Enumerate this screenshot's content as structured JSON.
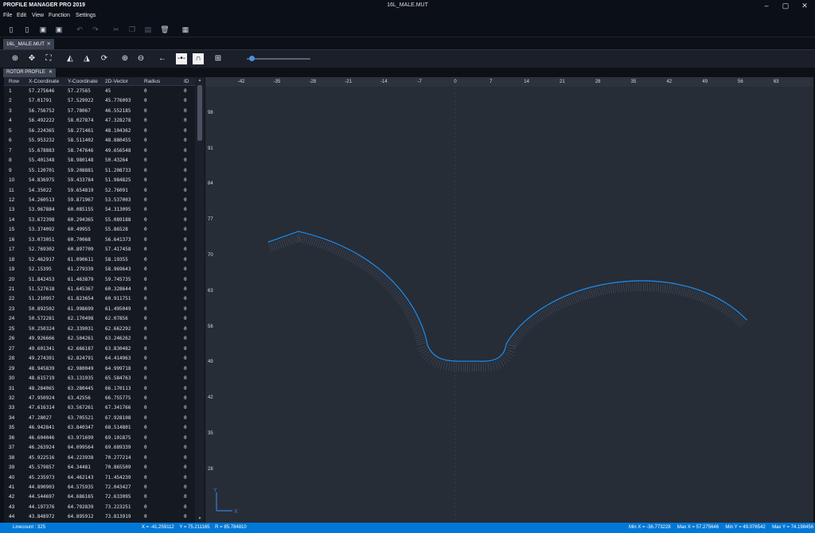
{
  "window": {
    "app_title": "PROFILE MANAGER PRO 2019",
    "file_title": "16L_MALE.MUT"
  },
  "menu": [
    "File",
    "Edit",
    "View",
    "Function",
    "Settings"
  ],
  "document_tab": "16L_MALE.MUT",
  "view_tab": "ROTOR PROFILE",
  "table": {
    "headers": [
      "Row",
      "X-Coordinate",
      "Y-Coordinate",
      "2D-Vector",
      "Radius",
      "ID"
    ],
    "rows": [
      [
        "1",
        "57.275646",
        "57.27565",
        "45",
        "0",
        "0"
      ],
      [
        "2",
        "57.01791",
        "57.529922",
        "45.776093",
        "0",
        "0"
      ],
      [
        "3",
        "56.756752",
        "57.78067",
        "46.552185",
        "0",
        "0"
      ],
      [
        "4",
        "56.492222",
        "58.027874",
        "47.328278",
        "0",
        "0"
      ],
      [
        "5",
        "56.224365",
        "58.271461",
        "48.104362",
        "0",
        "0"
      ],
      [
        "6",
        "55.953232",
        "58.511402",
        "48.880455",
        "0",
        "0"
      ],
      [
        "7",
        "55.678883",
        "58.747646",
        "49.656548",
        "0",
        "0"
      ],
      [
        "8",
        "55.401348",
        "58.980148",
        "50.43264",
        "0",
        "0"
      ],
      [
        "9",
        "55.120701",
        "59.208881",
        "51.208733",
        "0",
        "0"
      ],
      [
        "10",
        "54.836975",
        "59.433784",
        "51.984825",
        "0",
        "0"
      ],
      [
        "11",
        "54.35022",
        "59.654819",
        "52.76091",
        "0",
        "0"
      ],
      [
        "12",
        "54.260513",
        "59.871967",
        "53.537003",
        "0",
        "0"
      ],
      [
        "13",
        "53.967884",
        "60.085155",
        "54.313095",
        "0",
        "0"
      ],
      [
        "14",
        "53.672398",
        "60.294365",
        "55.089188",
        "0",
        "0"
      ],
      [
        "15",
        "53.374092",
        "60.49955",
        "55.86528",
        "0",
        "0"
      ],
      [
        "16",
        "53.073051",
        "60.70068",
        "56.641373",
        "0",
        "0"
      ],
      [
        "17",
        "52.769302",
        "60.897709",
        "57.417458",
        "0",
        "0"
      ],
      [
        "18",
        "52.462917",
        "61.090611",
        "58.19355",
        "0",
        "0"
      ],
      [
        "19",
        "52.15395",
        "61.279339",
        "58.969643",
        "0",
        "0"
      ],
      [
        "20",
        "51.842453",
        "61.463879",
        "59.745735",
        "0",
        "0"
      ],
      [
        "21",
        "51.527618",
        "61.645367",
        "60.328644",
        "0",
        "0"
      ],
      [
        "22",
        "51.210957",
        "61.823654",
        "60.911751",
        "0",
        "0"
      ],
      [
        "23",
        "50.892502",
        "61.998699",
        "61.495049",
        "0",
        "0"
      ],
      [
        "24",
        "50.572281",
        "62.170498",
        "62.07856",
        "0",
        "0"
      ],
      [
        "25",
        "50.250324",
        "62.339031",
        "62.662292",
        "0",
        "0"
      ],
      [
        "26",
        "49.926666",
        "62.504261",
        "63.246262",
        "0",
        "0"
      ],
      [
        "27",
        "49.601341",
        "62.666187",
        "63.830482",
        "0",
        "0"
      ],
      [
        "28",
        "49.274391",
        "62.824791",
        "64.414963",
        "0",
        "0"
      ],
      [
        "29",
        "48.945839",
        "62.980049",
        "64.999718",
        "0",
        "0"
      ],
      [
        "30",
        "48.615719",
        "63.131935",
        "65.584763",
        "0",
        "0"
      ],
      [
        "31",
        "48.284065",
        "63.280445",
        "66.170113",
        "0",
        "0"
      ],
      [
        "32",
        "47.950924",
        "63.42556",
        "66.755775",
        "0",
        "0"
      ],
      [
        "33",
        "47.616314",
        "63.567261",
        "67.341766",
        "0",
        "0"
      ],
      [
        "34",
        "47.28027",
        "63.705521",
        "67.928108",
        "0",
        "0"
      ],
      [
        "35",
        "46.942841",
        "63.840347",
        "68.514801",
        "0",
        "0"
      ],
      [
        "36",
        "46.604046",
        "63.971699",
        "69.101875",
        "0",
        "0"
      ],
      [
        "37",
        "46.263924",
        "64.099564",
        "69.689339",
        "0",
        "0"
      ],
      [
        "38",
        "45.922516",
        "64.223938",
        "70.277214",
        "0",
        "0"
      ],
      [
        "39",
        "45.579857",
        "64.34481",
        "70.865509",
        "0",
        "0"
      ],
      [
        "40",
        "45.235973",
        "64.462143",
        "71.454239",
        "0",
        "0"
      ],
      [
        "41",
        "44.890903",
        "64.575935",
        "72.043427",
        "0",
        "0"
      ],
      [
        "42",
        "44.544697",
        "64.686165",
        "72.633095",
        "0",
        "0"
      ],
      [
        "43",
        "44.197376",
        "64.792839",
        "73.223251",
        "0",
        "0"
      ],
      [
        "44",
        "43.848972",
        "64.895912",
        "73.813919",
        "0",
        "0"
      ]
    ]
  },
  "plot": {
    "x_ticks": [
      "-42",
      "-35",
      "-28",
      "-21",
      "-14",
      "-7",
      "0",
      "7",
      "14",
      "21",
      "28",
      "35",
      "42",
      "49",
      "56",
      "63"
    ],
    "y_ticks": [
      "98",
      "91",
      "84",
      "77",
      "70",
      "63",
      "56",
      "49",
      "42",
      "35",
      "28"
    ],
    "curve_color": "#1e88e5",
    "axis_x_label": "X",
    "axis_y_label": "Y",
    "profile": {
      "start": [
        -36.77,
        72.6
      ],
      "p1": [
        -30.8,
        74.7
      ],
      "ctrl1a": [
        -10.5,
        70.0
      ],
      "ctrl1b": [
        -6.0,
        56.0
      ],
      "p2": [
        -5.5,
        52.5
      ],
      "ctrl2a": [
        -4.0,
        48.5
      ],
      "ctrl2b": [
        0.0,
        49.3
      ],
      "p3": [
        4.8,
        49.2
      ],
      "ctrl3a": [
        9.0,
        49.0
      ],
      "ctrl3b": [
        9.8,
        51.0
      ],
      "p4": [
        10.0,
        52.6
      ],
      "ctrl4a": [
        18.0,
        66.0
      ],
      "ctrl4b": [
        45.0,
        70.0
      ],
      "end": [
        57.27,
        57.28
      ]
    }
  },
  "status": {
    "linecount": "Linecount : 325",
    "cursor": "X = -41.259112    Y = 75.211165    R = 85.784810",
    "maxmin": "Min X = -36.773228     Max X = 57.275646     Min Y = 49.076542     Max Y = 74.198456"
  }
}
